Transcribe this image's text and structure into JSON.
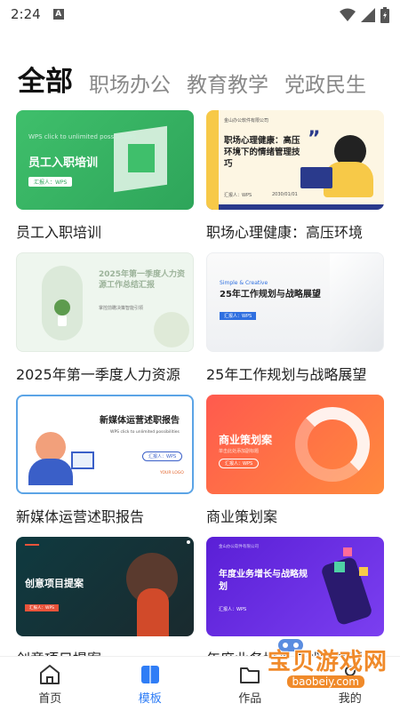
{
  "status": {
    "time": "2:24",
    "a_label": "A"
  },
  "tabs": [
    {
      "label": "全部"
    },
    {
      "label": "职场办公"
    },
    {
      "label": "教育教学"
    },
    {
      "label": "党政民生"
    }
  ],
  "cards": [
    {
      "title": "员工入职培训",
      "thumb_heading": "员工入职培训",
      "thumb_small": "WPS click to unlimited possibilities",
      "thumb_tag": "汇报人：WPS"
    },
    {
      "title": "职场心理健康：高压环境",
      "thumb_heading": "职场心理健康：高压环境下的情绪管理技巧",
      "thumb_small": "金山办公软件有限公司",
      "thumb_tag": "汇报人：WPS",
      "thumb_date": "2030/01/01"
    },
    {
      "title": "2025年第一季度人力资源",
      "thumb_heading": "2025年第一季度人力资源工作总结汇报",
      "thumb_small": "掌控前瞻决策智能引领"
    },
    {
      "title": "25年工作规划与战略展望",
      "thumb_heading": "25年工作规划与战略展望",
      "thumb_small": "Simple & Creative",
      "thumb_tag": "汇报人：WPS"
    },
    {
      "title": "新媒体运营述职报告",
      "thumb_heading": "新媒体运营述职报告",
      "thumb_small": "WPS click to unlimited possibilities",
      "thumb_tag": "汇报人：WPS",
      "thumb_logo": "YOUR LOGO"
    },
    {
      "title": "商业策划案",
      "thumb_heading": "商业策划案",
      "thumb_small": "单击此处添加副标题",
      "thumb_tag": "汇报人：WPS"
    },
    {
      "title": "创意项目提案",
      "thumb_heading": "创意项目提案",
      "thumb_tag": "汇报人：WPS"
    },
    {
      "title": "年度业务增长与战略规划",
      "thumb_heading": "年度业务增长与战略规划",
      "thumb_small": "金山办公软件有限公司",
      "thumb_tag": "汇报人：WPS"
    }
  ],
  "bottom_nav": [
    {
      "label": "首页",
      "icon": "home-icon"
    },
    {
      "label": "模板",
      "icon": "template-icon"
    },
    {
      "label": "作品",
      "icon": "folder-icon"
    },
    {
      "label": "我的",
      "icon": "profile-icon"
    }
  ],
  "watermark": {
    "text": "宝贝游戏网",
    "url": "baobeiy.com"
  },
  "colors": {
    "accent": "#2f7df6",
    "nav_text": "#333333"
  }
}
